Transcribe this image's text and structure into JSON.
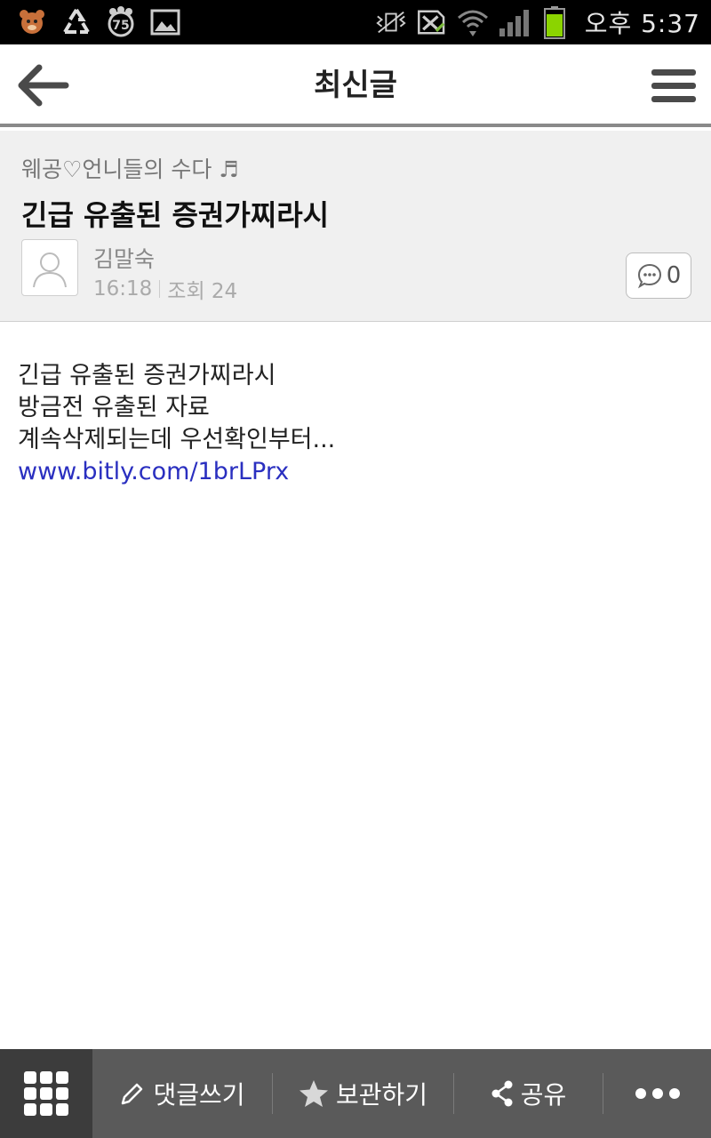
{
  "status_bar": {
    "time": "오후 5:37",
    "battery_color": "#8bd400",
    "icons": [
      "dog-bear-icon",
      "recycle-icon",
      "paw-battery-icon",
      "image-icon",
      "mute-vibrate-icon",
      "no-sim-icon",
      "wifi-icon",
      "signal-icon",
      "battery-icon"
    ],
    "paw_badge": "75"
  },
  "header": {
    "title": "최신글"
  },
  "post": {
    "board_name": "웨공♡언니들의 수다 ♬",
    "title": "긴급 유출된 증권가찌라시",
    "author": "김말숙",
    "time": "16:18",
    "views": "조회 24",
    "comment_count": "0"
  },
  "content": {
    "lines": [
      "긴급 유출된 증권가찌라시",
      "방금전 유출된 자료",
      "계속삭제되는데 우선확인부터..."
    ],
    "link": "www.bitly.com/1brLPrx"
  },
  "toolbar": {
    "comment_label": "댓글쓰기",
    "save_label": "보관하기",
    "share_label": "공유"
  },
  "colors": {
    "link": "#2a2fc0",
    "toolbar_bg": "#5a5a5a",
    "header_divider": "#8a8a8a"
  }
}
